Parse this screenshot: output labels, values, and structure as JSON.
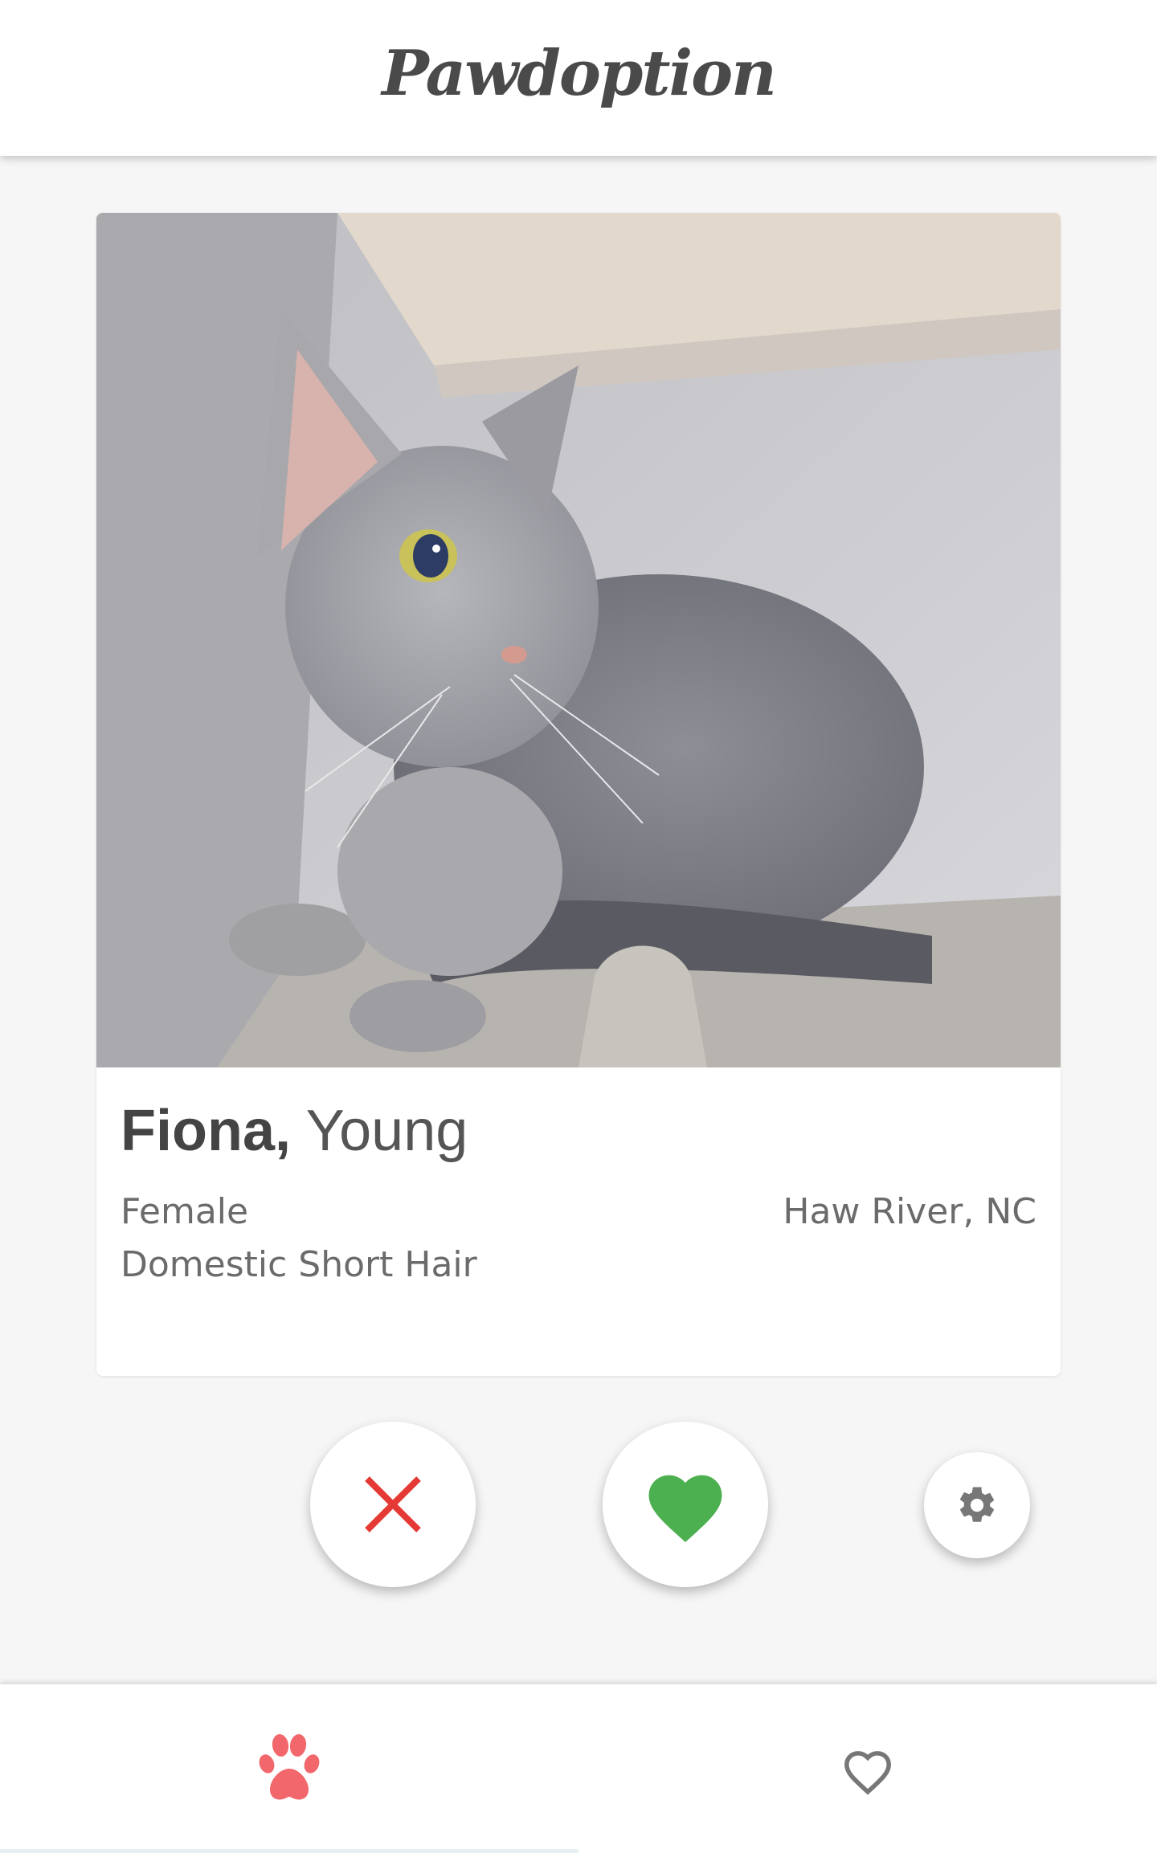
{
  "app": {
    "title": "Pawdoption"
  },
  "pet": {
    "name": "Fiona,",
    "age": "Young",
    "gender": "Female",
    "breed": "Domestic Short Hair",
    "location": "Haw River, NC"
  },
  "actions": {
    "pass_icon": "close-icon",
    "like_icon": "heart-icon",
    "settings_icon": "gear-icon"
  },
  "nav": {
    "items": [
      {
        "icon": "paw-icon",
        "active": true
      },
      {
        "icon": "heart-outline-icon",
        "active": false
      }
    ]
  },
  "colors": {
    "pass": "#e53935",
    "like": "#4caf50",
    "paw_active": "#f2676b",
    "icon_inactive": "#777777",
    "text": "#444444"
  }
}
